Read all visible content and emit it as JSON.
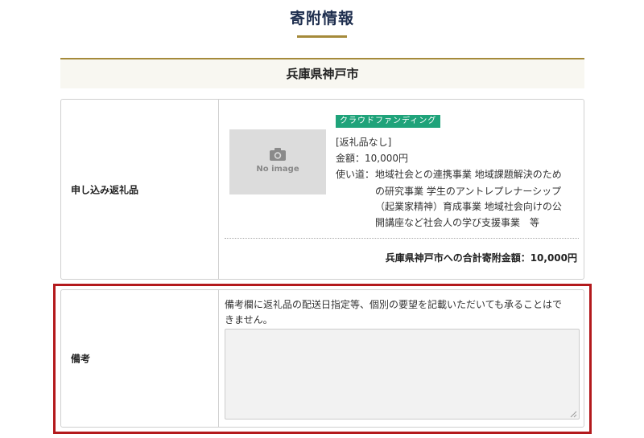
{
  "header": {
    "title": "寄附情報"
  },
  "city": {
    "name": "兵庫県神戸市"
  },
  "gift": {
    "label": "申し込み返礼品",
    "image_placeholder": "No image",
    "badge": "クラウドファンディング",
    "name": "[返礼品なし]",
    "amount": "金額：10,000円",
    "usage_label": "使い道：",
    "usage_lines": [
      "地域社会との連携事業 地域課題解決のため",
      "の研究事業 学生のアントレプレナーシップ",
      "（起業家精神）育成事業 地域社会向けの公",
      "開講座など社会人の学び支援事業　等"
    ],
    "total": "兵庫県神戸市への合計寄附金額：10,000円"
  },
  "remarks": {
    "label": "備考",
    "note_lines": [
      "備考欄に返礼品の配送日指定等、個別の要望を記載いただいても承ることはで",
      "きません。"
    ],
    "value": ""
  },
  "colors": {
    "accent_gold": "#a58a3a",
    "title_navy": "#1f2f4f",
    "badge_green": "#1fa37a",
    "highlight_red": "#b3191c"
  }
}
